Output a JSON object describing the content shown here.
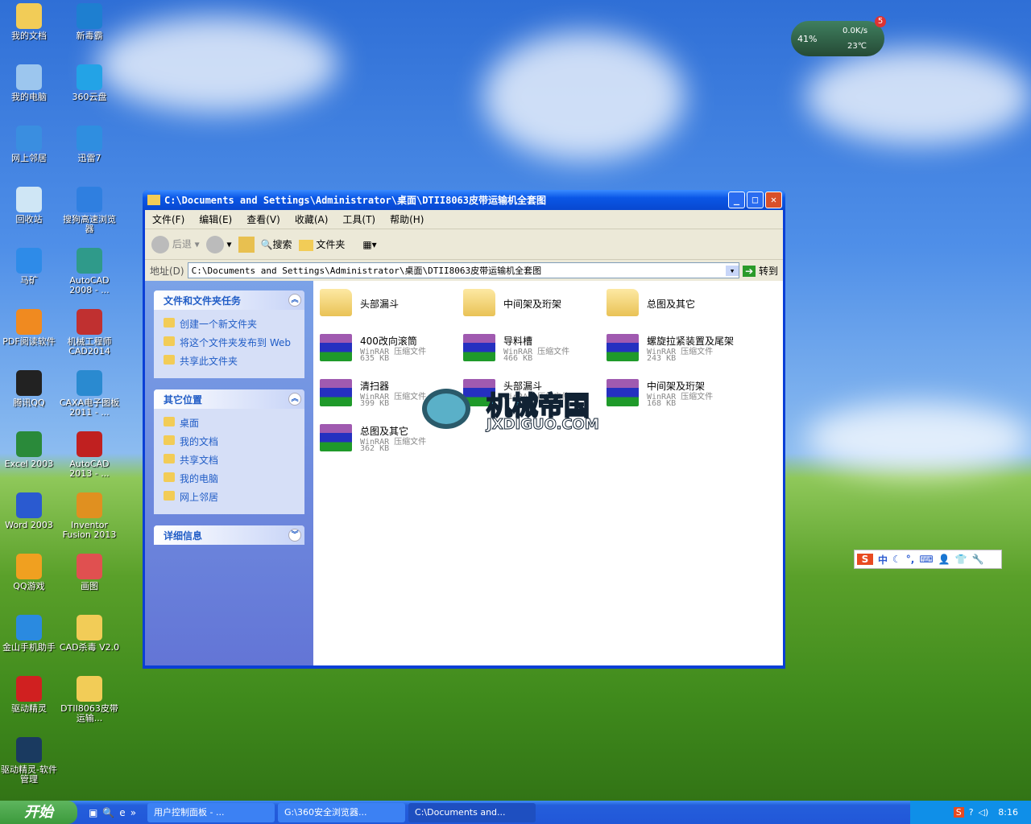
{
  "desktop": {
    "icons": [
      {
        "label": "我的文档",
        "color": "#f2cc57"
      },
      {
        "label": "新毒霸",
        "color": "#1e7fd0"
      },
      {
        "label": "我的电脑",
        "color": "#9cc6ee"
      },
      {
        "label": "360云盘",
        "color": "#23a3e6"
      },
      {
        "label": "网上邻居",
        "color": "#3a8ee0"
      },
      {
        "label": "迅雷7",
        "color": "#2f8ee0"
      },
      {
        "label": "回收站",
        "color": "#cfe6f5"
      },
      {
        "label": "搜狗高速浏览器",
        "color": "#2f7fe0"
      },
      {
        "label": "马矿",
        "color": "#2e8be8"
      },
      {
        "label": "AutoCAD 2008 - ...",
        "color": "#2f9a8a"
      },
      {
        "label": "PDF阅读软件",
        "color": "#f08a20"
      },
      {
        "label": "机械工程师CAD2014",
        "color": "#c03030"
      },
      {
        "label": "腾讯QQ",
        "color": "#222222"
      },
      {
        "label": "CAXA电子图板2011 - ...",
        "color": "#2a8ad0"
      },
      {
        "label": "Excel 2003",
        "color": "#2a8a3a"
      },
      {
        "label": "AutoCAD 2013 - ...",
        "color": "#c02020"
      },
      {
        "label": "Word 2003",
        "color": "#2a5ad0"
      },
      {
        "label": "Inventor Fusion 2013",
        "color": "#e09020"
      },
      {
        "label": "QQ游戏",
        "color": "#f0a020"
      },
      {
        "label": "画图",
        "color": "#e05050"
      },
      {
        "label": "金山手机助手",
        "color": "#2a8ae0"
      },
      {
        "label": "CAD杀毒 V2.0",
        "color": "#f2cc57"
      },
      {
        "label": "驱动精灵",
        "color": "#d02020"
      },
      {
        "label": "DTII8063皮带运输...",
        "color": "#f2cc57"
      },
      {
        "label": "驱动精灵-软件管理",
        "color": "#1a3a60"
      }
    ]
  },
  "widget": {
    "cpu": "41%",
    "speed": "0.0K/s",
    "temp": "23℃",
    "badge": "5"
  },
  "window": {
    "title": "C:\\Documents and Settings\\Administrator\\桌面\\DTII8063皮带运输机全套图",
    "menu": [
      "文件(F)",
      "编辑(E)",
      "查看(V)",
      "收藏(A)",
      "工具(T)",
      "帮助(H)"
    ],
    "toolbar": {
      "back": "后退",
      "search": "搜索",
      "folders": "文件夹"
    },
    "address": {
      "label": "地址(D)",
      "value": "C:\\Documents and Settings\\Administrator\\桌面\\DTII8063皮带运输机全套图",
      "go": "转到"
    },
    "panels": [
      {
        "title": "文件和文件夹任务",
        "items": [
          "创建一个新文件夹",
          "将这个文件夹发布到 Web",
          "共享此文件夹"
        ]
      },
      {
        "title": "其它位置",
        "items": [
          "桌面",
          "我的文档",
          "共享文档",
          "我的电脑",
          "网上邻居"
        ]
      },
      {
        "title": "详细信息",
        "items": []
      }
    ],
    "files": [
      {
        "name": "头部漏斗",
        "kind": "folder"
      },
      {
        "name": "中间架及珩架",
        "kind": "folder"
      },
      {
        "name": "总图及其它",
        "kind": "folder"
      },
      {
        "name": "400改向滚筒",
        "kind": "rar",
        "type": "WinRAR 压缩文件",
        "size": "635 KB"
      },
      {
        "name": "导料槽",
        "kind": "rar",
        "type": "WinRAR 压缩文件",
        "size": "466 KB"
      },
      {
        "name": "螺旋拉紧装置及尾架",
        "kind": "rar",
        "type": "WinRAR 压缩文件",
        "size": "243 KB"
      },
      {
        "name": "清扫器",
        "kind": "rar",
        "type": "WinRAR 压缩文件",
        "size": "399 KB"
      },
      {
        "name": "头部漏斗",
        "kind": "rar",
        "type": "WinRAR 压缩文件",
        "size": ""
      },
      {
        "name": "中间架及珩架",
        "kind": "rar",
        "type": "WinRAR 压缩文件",
        "size": "168 KB"
      },
      {
        "name": "总图及其它",
        "kind": "rar",
        "type": "WinRAR 压缩文件",
        "size": "362 KB"
      }
    ]
  },
  "watermark": {
    "cn": "机械帝国",
    "en": "JXDIGUO.COM"
  },
  "ime": {
    "label": "中"
  },
  "taskbar": {
    "start": "开始",
    "tasks": [
      "用户控制面板 - ...",
      "G:\\360安全浏览器...",
      "C:\\Documents and..."
    ],
    "clock": "8:16"
  }
}
